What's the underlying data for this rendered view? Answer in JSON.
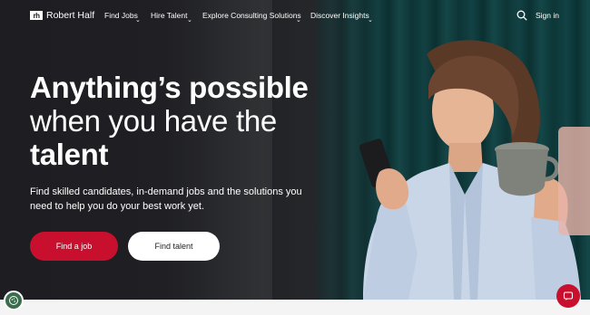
{
  "brand": {
    "name": "Robert Half",
    "mark": "rh"
  },
  "nav": {
    "items": [
      "Find Jobs",
      "Hire Talent",
      "Explore Consulting Solutions",
      "Discover Insights"
    ],
    "signin": "Sign in",
    "icons": [
      "search-icon"
    ]
  },
  "hero": {
    "title_line1": "Anything’s possible",
    "title_line2": "when you have the",
    "title_line3": "talent",
    "subtitle": "Find skilled candidates, in-demand jobs and the solutions you need to help you do your best work yet.",
    "cta_primary": "Find a job",
    "cta_secondary": "Find talent"
  },
  "colors": {
    "accent": "#c8102e",
    "background": "#1f1f23",
    "curtain": "#0f3a3c"
  },
  "widgets": {
    "cookie_icon": "cookie-icon",
    "chat_icon": "chat-icon"
  }
}
